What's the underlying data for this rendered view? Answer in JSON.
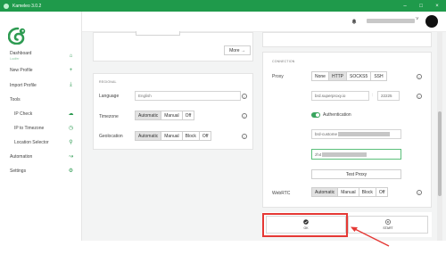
{
  "window": {
    "title": "Kameleo 3.0.2"
  },
  "sidebar": {
    "dashboard": {
      "label": "Dashboard",
      "sub": "Lucifer"
    },
    "items": [
      {
        "label": "New Profile",
        "icon": "plus-icon"
      },
      {
        "label": "Import Profile",
        "icon": "download-icon"
      },
      {
        "label": "Tools",
        "icon": ""
      },
      {
        "label": "IP Check",
        "icon": "cloud-icon"
      },
      {
        "label": "IP to Timezone",
        "icon": "clock-icon"
      },
      {
        "label": "Location Selector",
        "icon": "pin-icon"
      },
      {
        "label": "Automation",
        "icon": "chart-icon"
      },
      {
        "label": "Settings",
        "icon": "gear-icon"
      }
    ]
  },
  "left_panel": {
    "more_button": "More →",
    "section_title": "REGIONAL",
    "language": {
      "label": "Language",
      "placeholder": "English"
    },
    "timezone": {
      "label": "Timezone",
      "options": [
        "Automatic",
        "Manual",
        "Off"
      ],
      "selected": "Automatic"
    },
    "geolocation": {
      "label": "Geolocation",
      "options": [
        "Automatic",
        "Manual",
        "Block",
        "Off"
      ],
      "selected": "Automatic"
    }
  },
  "right_panel": {
    "section_title": "CONNECTION",
    "proxy": {
      "label": "Proxy",
      "options": [
        "None",
        "HTTP",
        "SOCKS5",
        "SSH"
      ],
      "selected": "HTTP"
    },
    "host": "brd.superproxy.io",
    "port": "22225",
    "auth_label": "Authentication",
    "username_prefix": "brd-custome",
    "password_prefix": "zh4",
    "test_proxy": "Test Proxy",
    "webrtc": {
      "label": "WebRTC",
      "options": [
        "Automatic",
        "Manual",
        "Block",
        "Off"
      ],
      "selected": "Automatic"
    }
  },
  "actions": {
    "ok": "OK",
    "start": "START"
  },
  "colors": {
    "brand": "#1f9a4b",
    "accent": "#39a55e",
    "highlight": "#e53935"
  }
}
